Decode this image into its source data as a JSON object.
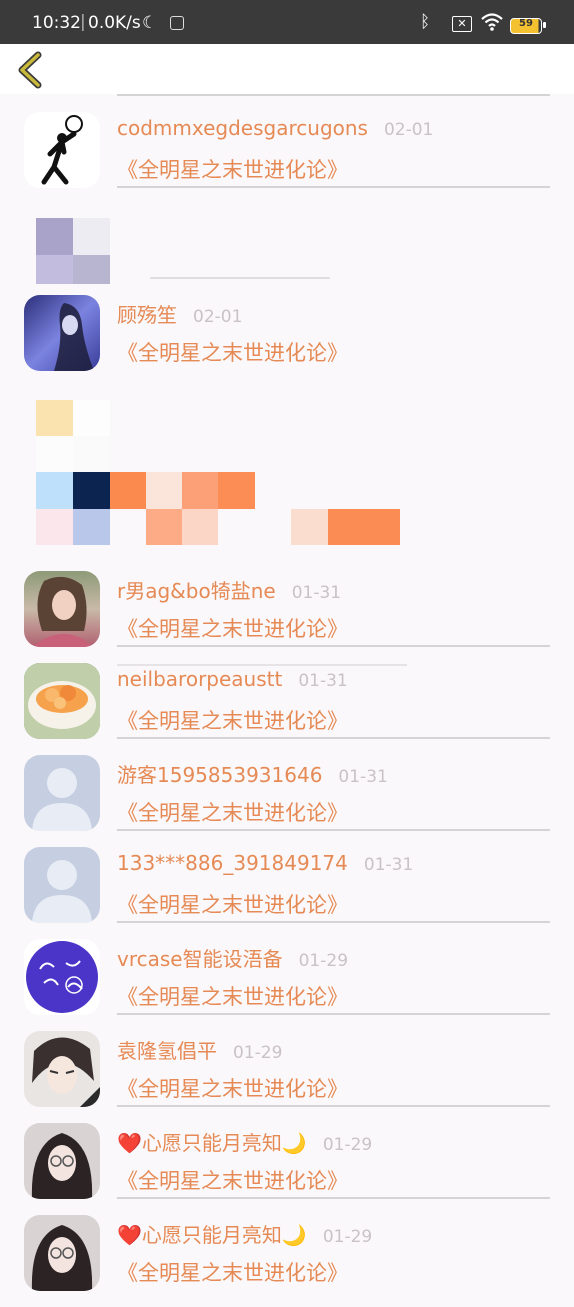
{
  "status": {
    "time": "10:32",
    "speed": "0.0K/s",
    "battery": "59"
  },
  "book_title": "《全明星之末世进化论》",
  "items": [
    {
      "name": "codmmxegdesgarcugons",
      "date": "02-01",
      "avatar": "sketch-avatar"
    },
    {
      "name": "顾殇笙",
      "date": "02-01",
      "avatar": "blue-photo-avatar"
    },
    {
      "name": "r男ag&bo犄盐ne",
      "date": "01-31",
      "avatar": "girl-photo-avatar"
    },
    {
      "name": "neilbarorpeaustt",
      "date": "01-31",
      "avatar": "food-avatar"
    },
    {
      "name": "游客1595853931646",
      "date": "01-31",
      "avatar": "default-avatar"
    },
    {
      "name": "133***886_391849174",
      "date": "01-31",
      "avatar": "default-avatar"
    },
    {
      "name": "vrcase智能设浯备",
      "date": "01-29",
      "avatar": "purple-logo-avatar"
    },
    {
      "name": "袁隆氢倡平",
      "date": "01-29",
      "avatar": "anime-avatar"
    },
    {
      "name": "❤️心愿只能月亮知🌙",
      "date": "01-29",
      "avatar": "girl-glasses-avatar"
    },
    {
      "name": "❤️心愿只能月亮知🌙",
      "date": "01-29",
      "avatar": "girl-glasses-avatar"
    }
  ],
  "colors": {
    "accent": "#e68a55",
    "date": "#c9c2c6",
    "back_arrow": "#a89a2c"
  }
}
